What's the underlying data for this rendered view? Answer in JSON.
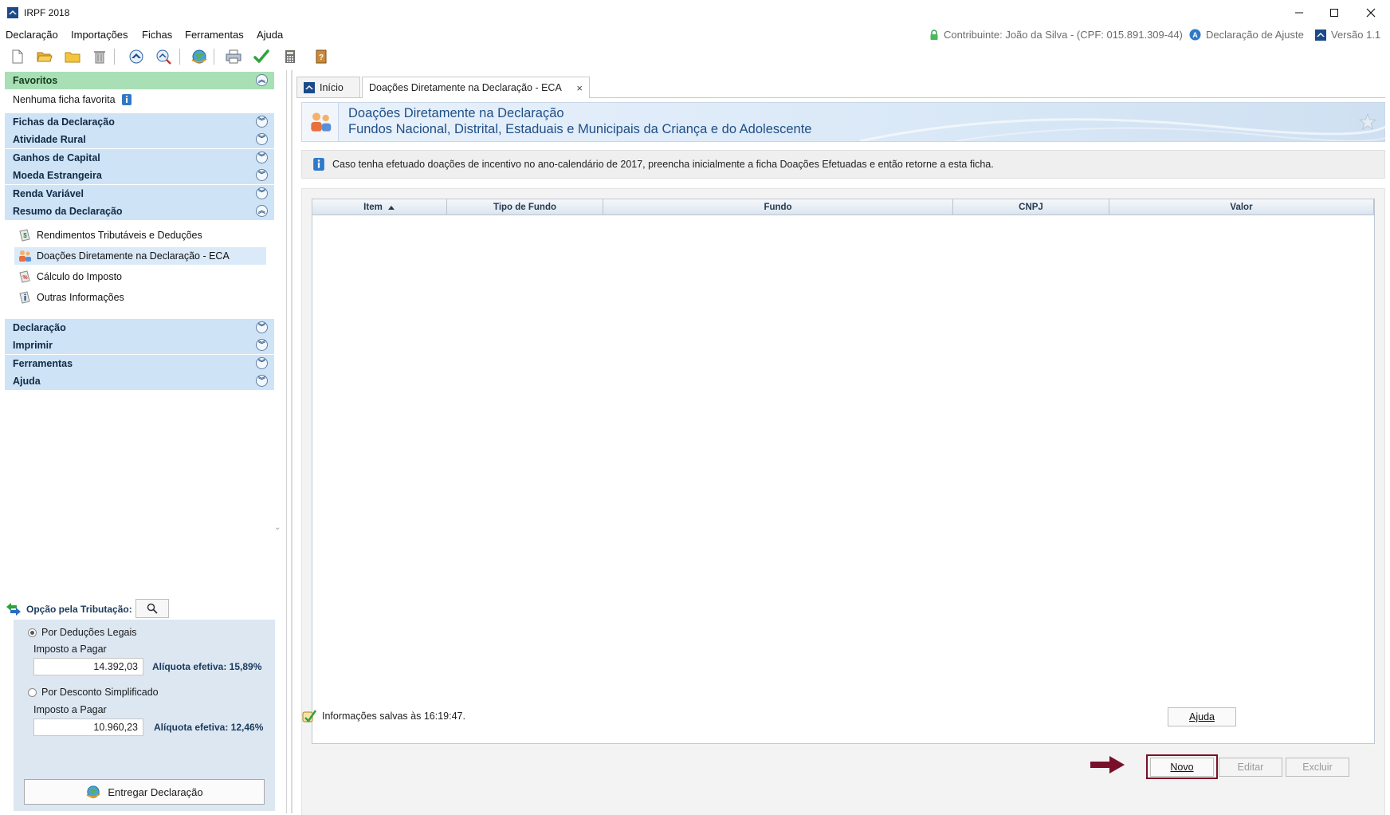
{
  "window": {
    "title": "IRPF 2018",
    "controls": [
      "minimize",
      "maximize",
      "close"
    ]
  },
  "menu": {
    "items": [
      "Declaração",
      "Importações",
      "Fichas",
      "Ferramentas",
      "Ajuda"
    ],
    "contribuinte": "Contribuinte: João da Silva - (CPF: 015.891.309-44)",
    "tipo": "Declaração de Ajuste",
    "versao": "Versão 1.1"
  },
  "toolbar": {
    "icons": [
      "new-file-icon",
      "open-folder-icon",
      "folder-icon",
      "trash-icon",
      "receita-up-icon",
      "receita-search-icon",
      "globe-send-icon",
      "printer-icon",
      "check-icon",
      "calculator-icon",
      "help-book-icon"
    ]
  },
  "sidebar": {
    "favoritos": {
      "label": "Favoritos",
      "empty_text": "Nenhuma ficha favorita"
    },
    "sections_top": [
      "Fichas da Declaração",
      "Atividade Rural",
      "Ganhos de Capital",
      "Moeda Estrangeira",
      "Renda Variável",
      "Resumo da Declaração"
    ],
    "resumo_items": [
      "Rendimentos Tributáveis e Deduções",
      "Doações Diretamente na Declaração - ECA",
      "Cálculo do Imposto",
      "Outras Informações"
    ],
    "selected_item": "Doações Diretamente na Declaração - ECA",
    "sections_bottom": [
      "Declaração",
      "Imprimir",
      "Ferramentas",
      "Ajuda"
    ]
  },
  "tributacao": {
    "label": "Opção pela Tributação:",
    "legais": {
      "label": "Por Deduções Legais",
      "selected": true,
      "imposto_label": "Imposto a Pagar",
      "valor": "14.392,03",
      "aliquota": "Alíquota efetiva: 15,89%"
    },
    "simplificado": {
      "label": "Por Desconto Simplificado",
      "selected": false,
      "imposto_label": "Imposto a Pagar",
      "valor": "10.960,23",
      "aliquota": "Alíquota efetiva: 12,46%"
    },
    "entregar_label": "Entregar Declaração"
  },
  "tabs": [
    {
      "label": "Início",
      "active": false
    },
    {
      "label": "Doações Diretamente na Declaração - ECA",
      "active": true,
      "closable": true,
      "close_glyph": "×"
    }
  ],
  "header": {
    "title": "Doações Diretamente na Declaração",
    "subtitle": "Fundos Nacional, Distrital, Estaduais e Municipais da Criança e do Adolescente"
  },
  "info": {
    "text": "Caso tenha efetuado doações de incentivo no ano-calendário de 2017, preencha inicialmente a ficha Doações Efetuadas e então retorne a esta ficha."
  },
  "table": {
    "columns": [
      "Item",
      "Tipo de Fundo",
      "Fundo",
      "CNPJ",
      "Valor"
    ],
    "sort_column": "Item",
    "sort_dir": "asc",
    "rows": []
  },
  "actions": {
    "novo": "Novo",
    "editar": "Editar",
    "excluir": "Excluir"
  },
  "footer": {
    "saved_text": "Informações salvas às 16:19:47.",
    "ajuda": "Ajuda"
  },
  "colors": {
    "accent_highlight": "#7a0f2a",
    "section_header": "#cfe3f6",
    "favoritos_header": "#a8dfb4",
    "header_text": "#1f4f86"
  }
}
